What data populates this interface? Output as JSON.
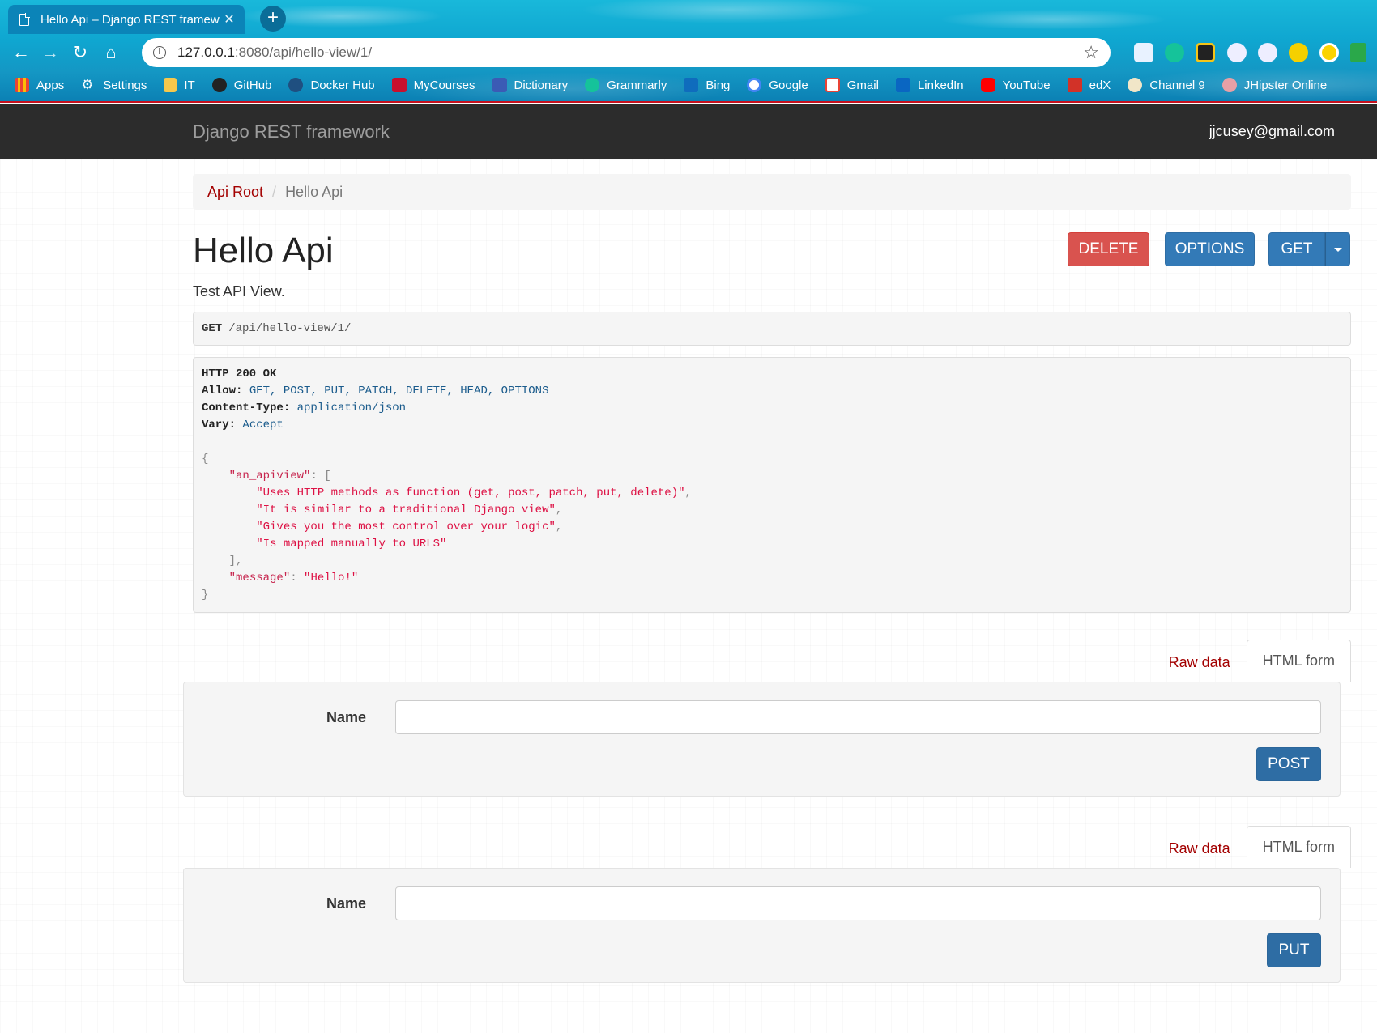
{
  "browser": {
    "tab_title": "Hello Api – Django REST framew",
    "url_host": "127.0.0.1",
    "url_rest": ":8080/api/hello-view/1/",
    "bookmarks": [
      {
        "label": "Apps",
        "icon": "apps-grid-icon",
        "color": "#f4b400"
      },
      {
        "label": "Settings",
        "icon": "gear-icon",
        "color": "#ffffff"
      },
      {
        "label": "IT",
        "icon": "folder-icon",
        "color": "#f6c84c"
      },
      {
        "label": "GitHub",
        "icon": "github-icon",
        "color": "#222222"
      },
      {
        "label": "Docker Hub",
        "icon": "docker-icon",
        "color": "#1f6bb0"
      },
      {
        "label": "MyCourses",
        "icon": "mycourses-icon",
        "color": "#c8102e"
      },
      {
        "label": "Dictionary",
        "icon": "dictionary-icon",
        "color": "#3b5bb5"
      },
      {
        "label": "Grammarly",
        "icon": "grammarly-icon",
        "color": "#15c39a"
      },
      {
        "label": "Bing",
        "icon": "bing-icon",
        "color": "#0f6cbd"
      },
      {
        "label": "Google",
        "icon": "google-icon",
        "color": "#ffffff"
      },
      {
        "label": "Gmail",
        "icon": "gmail-icon",
        "color": "#ea4335"
      },
      {
        "label": "LinkedIn",
        "icon": "linkedin-icon",
        "color": "#0a66c2"
      },
      {
        "label": "YouTube",
        "icon": "youtube-icon",
        "color": "#ff0000"
      },
      {
        "label": "edX",
        "icon": "edx-icon",
        "color": "#d23228"
      },
      {
        "label": "Channel 9",
        "icon": "channel9-icon",
        "color": "#f1e6c8"
      },
      {
        "label": "JHipster Online",
        "icon": "jhipster-icon",
        "color": "#e7a0a6"
      }
    ]
  },
  "navbar": {
    "brand": "Django REST framework",
    "user": "jjcusey@gmail.com"
  },
  "breadcrumb": {
    "root": "Api Root",
    "separator": "/",
    "current": "Hello Api"
  },
  "page": {
    "title": "Hello Api",
    "description": "Test API View.",
    "buttons": {
      "delete": "DELETE",
      "options": "OPTIONS",
      "get": "GET"
    }
  },
  "request": {
    "method": "GET",
    "path": "/api/hello-view/1/"
  },
  "response": {
    "status": "HTTP 200 OK",
    "headers": [
      {
        "key": "Allow:",
        "value": "GET, POST, PUT, PATCH, DELETE, HEAD, OPTIONS"
      },
      {
        "key": "Content-Type:",
        "value": "application/json"
      },
      {
        "key": "Vary:",
        "value": "Accept"
      }
    ],
    "body": {
      "an_apiview_key": "\"an_apiview\"",
      "an_apiview": [
        "\"Uses HTTP methods as function (get, post, patch, put, delete)\"",
        "\"It is similar to a traditional Django view\"",
        "\"Gives you the most control over your logic\"",
        "\"Is mapped manually to URLS\""
      ],
      "message_key": "\"message\"",
      "message": "\"Hello!\""
    }
  },
  "forms": [
    {
      "raw_tab": "Raw data",
      "html_tab": "HTML form",
      "field_label": "Name",
      "field_value": "",
      "submit": "POST"
    },
    {
      "raw_tab": "Raw data",
      "html_tab": "HTML form",
      "field_label": "Name",
      "field_value": "",
      "submit": "PUT"
    }
  ],
  "colors": {
    "navbar_bg": "#2c2c2c",
    "link": "#a30000",
    "danger": "#d9534f",
    "primary": "#337ab7"
  }
}
